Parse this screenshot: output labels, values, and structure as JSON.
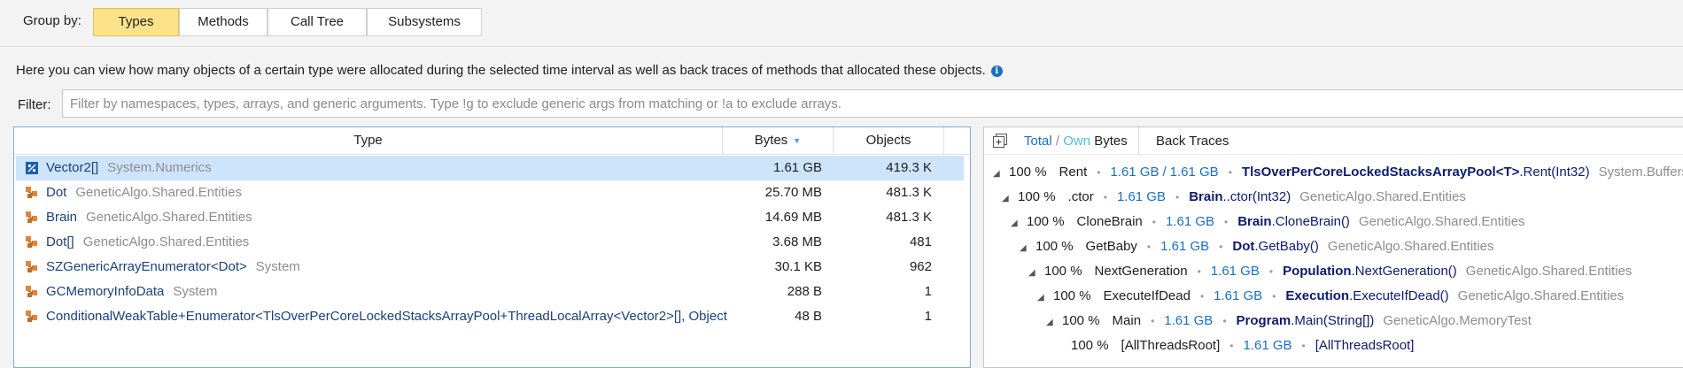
{
  "group_by": {
    "label": "Group by:",
    "buttons": [
      {
        "label": "Types",
        "active": true
      },
      {
        "label": "Methods",
        "active": false
      },
      {
        "label": "Call Tree",
        "active": false
      },
      {
        "label": "Subsystems",
        "active": false
      }
    ]
  },
  "description": "Here you can view how many objects of a certain type were allocated during the selected time interval as well as back traces of methods that allocated these objects.",
  "filter": {
    "label": "Filter:",
    "value": "",
    "placeholder": "Filter by namespaces, types, arrays, and generic arguments. Type !g to exclude generic args from matching or !a to exclude arrays."
  },
  "types_table": {
    "columns": {
      "type": "Type",
      "bytes": "Bytes",
      "objects": "Objects"
    },
    "sorted_column": "Bytes",
    "rows": [
      {
        "name": "Vector2[]",
        "ns": "System.Numerics",
        "bytes": "1.61 GB",
        "objects": "419.3 K",
        "icon": "array-icon",
        "selected": true
      },
      {
        "name": "Dot",
        "ns": "GeneticAlgo.Shared.Entities",
        "bytes": "25.70 MB",
        "objects": "481.3 K",
        "icon": "class-icon",
        "selected": false
      },
      {
        "name": "Brain",
        "ns": "GeneticAlgo.Shared.Entities",
        "bytes": "14.69 MB",
        "objects": "481.3 K",
        "icon": "class-icon",
        "selected": false
      },
      {
        "name": "Dot[]",
        "ns": "GeneticAlgo.Shared.Entities",
        "bytes": "3.68 MB",
        "objects": "481",
        "icon": "class-icon",
        "selected": false
      },
      {
        "name": "SZGenericArrayEnumerator<Dot>",
        "ns": "System",
        "bytes": "30.1 KB",
        "objects": "962",
        "icon": "class-icon",
        "selected": false
      },
      {
        "name": "GCMemoryInfoData",
        "ns": "System",
        "bytes": "288 B",
        "objects": "1",
        "icon": "class-icon",
        "selected": false
      },
      {
        "name": "ConditionalWeakTable+Enumerator<TlsOverPerCoreLockedStacksArrayPool+ThreadLocalArray<Vector2>[], Object",
        "ns": "",
        "bytes": "48 B",
        "objects": "1",
        "icon": "class-icon",
        "selected": false
      }
    ]
  },
  "back_traces": {
    "toggle_total": "Total",
    "toggle_slash": "/",
    "toggle_own": "Own",
    "toggle_bytes": "Bytes",
    "tab_label": "Back Traces",
    "rows": [
      {
        "pct": "100 %",
        "method": "Rent",
        "size": "1.61 GB",
        "own": "1.61 GB",
        "cls": "TlsOverPerCoreLockedStacksArrayPool<T>",
        "sig": ".Rent(Int32)",
        "ns": "System.Buffers",
        "expander": true
      },
      {
        "pct": "100 %",
        "method": ".ctor",
        "size": "1.61 GB",
        "own": "",
        "cls": "Brain",
        "sig": "..ctor(Int32)",
        "ns": "GeneticAlgo.Shared.Entities",
        "expander": true
      },
      {
        "pct": "100 %",
        "method": "CloneBrain",
        "size": "1.61 GB",
        "own": "",
        "cls": "Brain",
        "sig": ".CloneBrain()",
        "ns": "GeneticAlgo.Shared.Entities",
        "expander": true
      },
      {
        "pct": "100 %",
        "method": "GetBaby",
        "size": "1.61 GB",
        "own": "",
        "cls": "Dot",
        "sig": ".GetBaby()",
        "ns": "GeneticAlgo.Shared.Entities",
        "expander": true
      },
      {
        "pct": "100 %",
        "method": "NextGeneration",
        "size": "1.61 GB",
        "own": "",
        "cls": "Population",
        "sig": ".NextGeneration()",
        "ns": "GeneticAlgo.Shared.Entities",
        "expander": true
      },
      {
        "pct": "100 %",
        "method": "ExecuteIfDead",
        "size": "1.61 GB",
        "own": "",
        "cls": "Execution",
        "sig": ".ExecuteIfDead()",
        "ns": "GeneticAlgo.Shared.Entities",
        "expander": true
      },
      {
        "pct": "100 %",
        "method": "Main",
        "size": "1.61 GB",
        "own": "",
        "cls": "Program",
        "sig": ".Main(String[])",
        "ns": "GeneticAlgo.MemoryTest",
        "expander": true
      },
      {
        "pct": "100 %",
        "method": "[AllThreadsRoot]",
        "size": "1.61 GB",
        "own": "",
        "cls": "",
        "sig": "[AllThreadsRoot]",
        "ns": "",
        "expander": false
      }
    ]
  },
  "colors": {
    "accent_active": "#fde28c",
    "selection": "#cde4fb",
    "link_blue": "#1a6fc0",
    "own_cyan": "#4dbfd9",
    "class_navy": "#0d1b6b"
  }
}
